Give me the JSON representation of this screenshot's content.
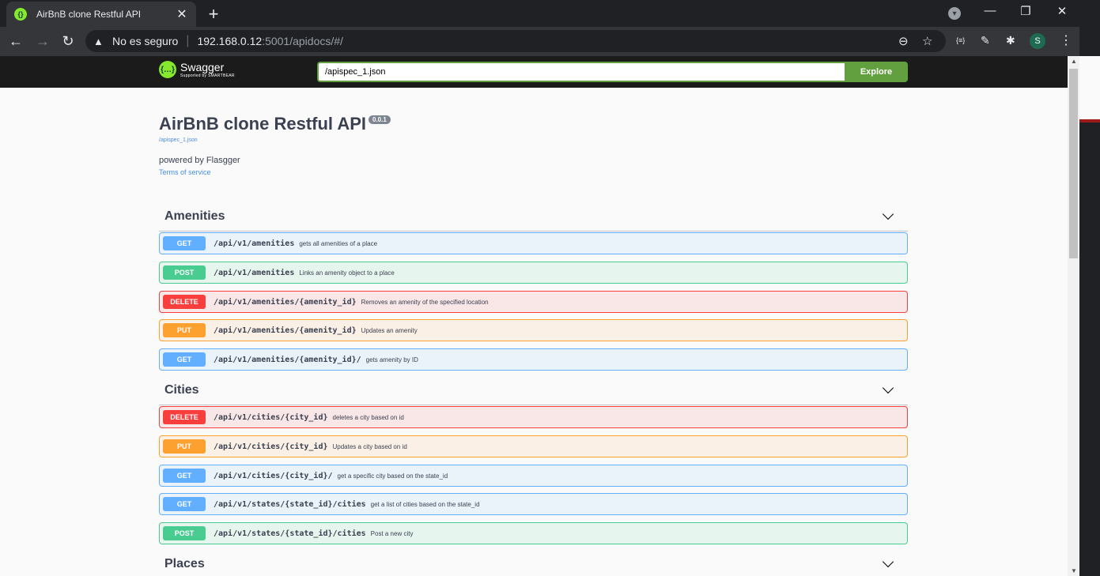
{
  "browser": {
    "tab_title": "AirBnB clone Restful API",
    "insecure_label": "No es seguro",
    "url_host": "192.168.0.12",
    "url_path": ":5001/apidocs/#/",
    "avatar_letter": "S"
  },
  "swagger": {
    "logo_name": "Swagger",
    "logo_sub": "Supported by SMARTBEAR",
    "spec_url": "/apispec_1.json",
    "explore_label": "Explore"
  },
  "info": {
    "title": "AirBnB clone Restful API",
    "version": "0.0.1",
    "spec_link": "/apispec_1.json",
    "description": "powered by Flasgger",
    "terms": "Terms of service"
  },
  "tags": [
    {
      "name": "Amenities",
      "operations": [
        {
          "method": "GET",
          "path": "/api/v1/amenities",
          "summary": "gets all amenities of a place"
        },
        {
          "method": "POST",
          "path": "/api/v1/amenities",
          "summary": "Links an amenity object to a place"
        },
        {
          "method": "DELETE",
          "path": "/api/v1/amenities/{amenity_id}",
          "summary": "Removes an amenity of the specified location"
        },
        {
          "method": "PUT",
          "path": "/api/v1/amenities/{amenity_id}",
          "summary": "Updates an amenity"
        },
        {
          "method": "GET",
          "path": "/api/v1/amenities/{amenity_id}/",
          "summary": "gets amenity by ID"
        }
      ]
    },
    {
      "name": "Cities",
      "operations": [
        {
          "method": "DELETE",
          "path": "/api/v1/cities/{city_id}",
          "summary": "deletes a city based on id"
        },
        {
          "method": "PUT",
          "path": "/api/v1/cities/{city_id}",
          "summary": "Updates a city based on id"
        },
        {
          "method": "GET",
          "path": "/api/v1/cities/{city_id}/",
          "summary": "get a specific city based on the state_id"
        },
        {
          "method": "GET",
          "path": "/api/v1/states/{state_id}/cities",
          "summary": "get a list of cities based on the state_id"
        },
        {
          "method": "POST",
          "path": "/api/v1/states/{state_id}/cities",
          "summary": "Post a new city"
        }
      ]
    },
    {
      "name": "Places",
      "operations": []
    }
  ]
}
